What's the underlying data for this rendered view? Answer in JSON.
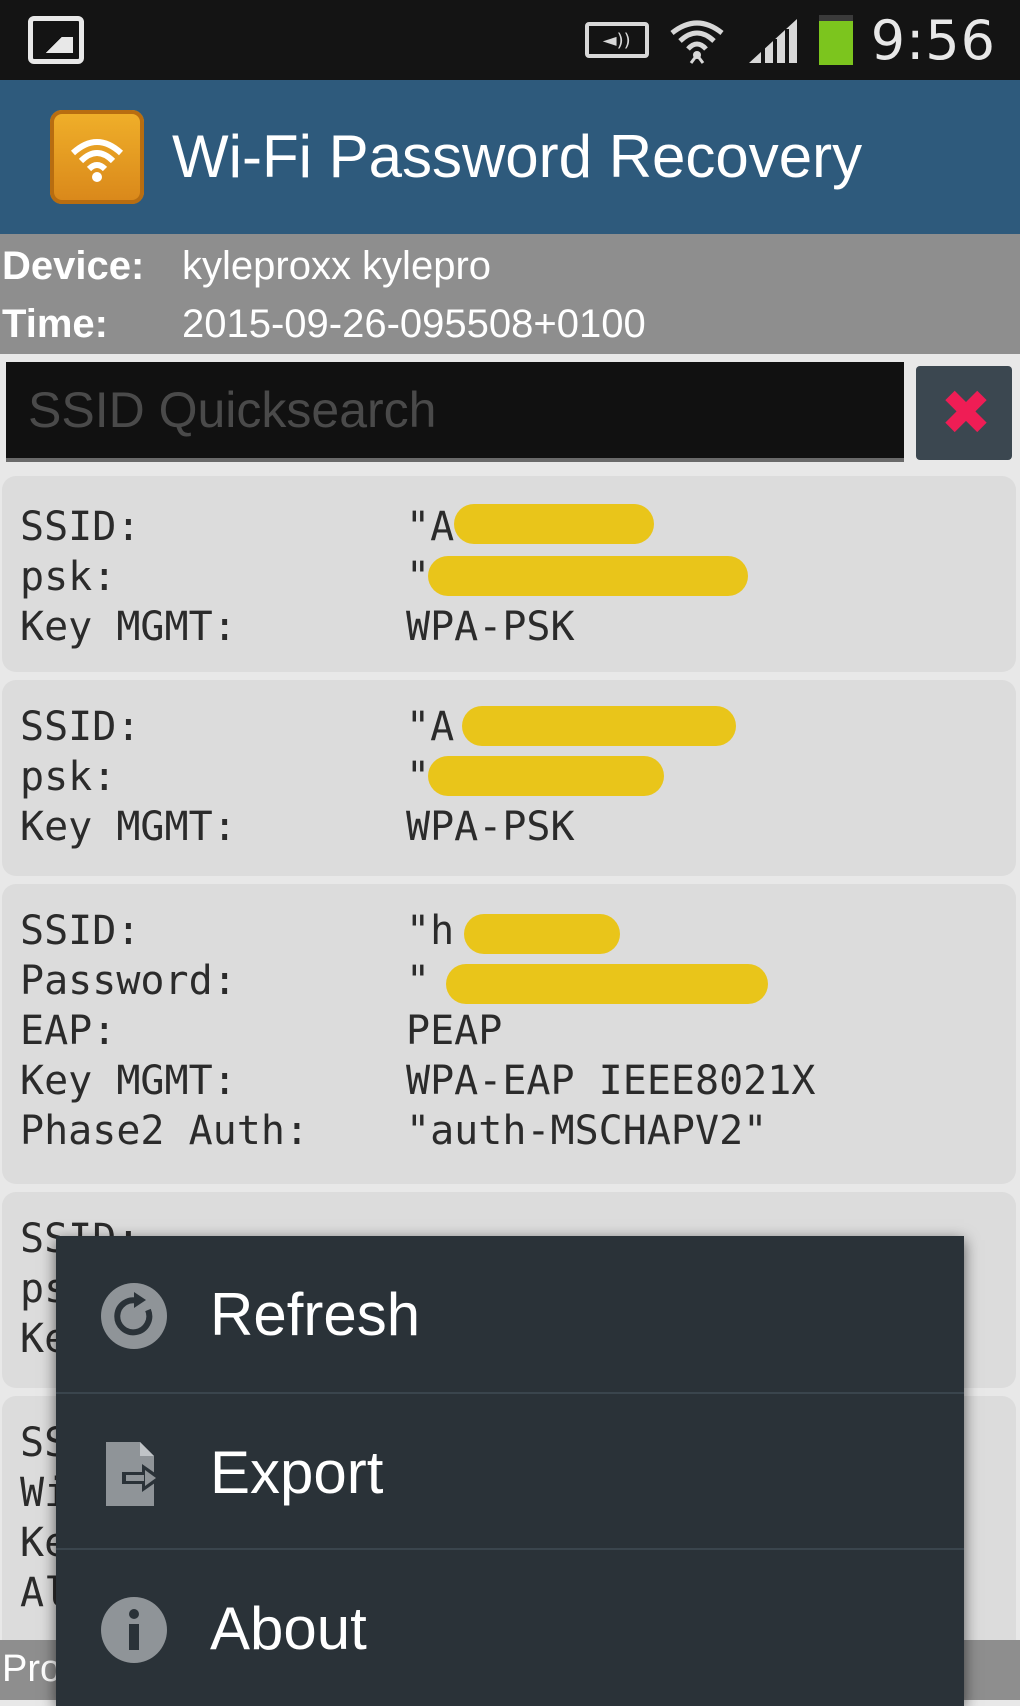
{
  "status_bar": {
    "time": "9:56"
  },
  "app": {
    "title": "Wi-Fi Password Recovery"
  },
  "info": {
    "device_label": "Device:",
    "device_value": "kyleproxx kylepro",
    "time_label": "Time:",
    "time_value": "2015-09-26-095508+0100"
  },
  "search": {
    "placeholder": "SSID Quicksearch",
    "clear_symbol": "✖"
  },
  "cards": [
    {
      "rows": [
        {
          "key": "SSID:",
          "value": "\"A"
        },
        {
          "key": "psk:",
          "value": "\""
        },
        {
          "key": "Key MGMT:",
          "value": "WPA-PSK"
        }
      ]
    },
    {
      "rows": [
        {
          "key": "SSID:",
          "value": "\"A"
        },
        {
          "key": "psk:",
          "value": "\""
        },
        {
          "key": "Key MGMT:",
          "value": "WPA-PSK"
        }
      ]
    },
    {
      "rows": [
        {
          "key": "SSID:",
          "value": "\"h"
        },
        {
          "key": "Password:",
          "value": "\""
        },
        {
          "key": "EAP:",
          "value": "PEAP"
        },
        {
          "key": "Key MGMT:",
          "value": "WPA-EAP IEEE8021X"
        },
        {
          "key": "Phase2 Auth:",
          "value": "\"auth-MSCHAPV2\""
        }
      ]
    },
    {
      "rows": [
        {
          "key": "SSID:",
          "value": ""
        },
        {
          "key": "psk:",
          "value": ""
        },
        {
          "key": "Key MGMT:",
          "value": ""
        }
      ]
    },
    {
      "rows": [
        {
          "key": "SSID:",
          "value": ""
        },
        {
          "key": "Wi",
          "value": ""
        },
        {
          "key": "Ke",
          "value": ""
        },
        {
          "key": "Al",
          "value": ""
        }
      ]
    }
  ],
  "menu": {
    "items": [
      {
        "label": "Refresh",
        "icon": "refresh-icon"
      },
      {
        "label": "Export",
        "icon": "export-icon"
      },
      {
        "label": "About",
        "icon": "info-icon"
      }
    ]
  },
  "bottom": {
    "text": "Pro"
  }
}
